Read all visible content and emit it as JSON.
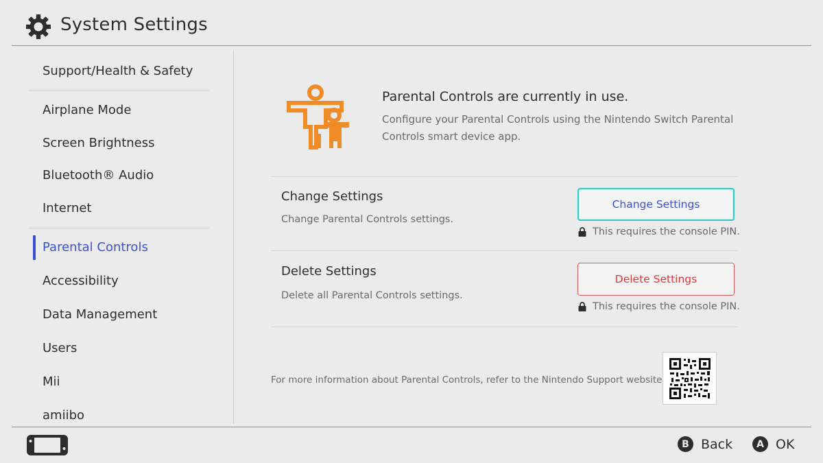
{
  "header": {
    "title": "System Settings",
    "icon": "gear-icon"
  },
  "sidebar": {
    "items": [
      {
        "label": "Support/Health & Safety"
      },
      {
        "label": "Airplane Mode"
      },
      {
        "label": "Screen Brightness"
      },
      {
        "label": "Bluetooth® Audio"
      },
      {
        "label": "Internet"
      },
      {
        "label": "Parental Controls",
        "active": true
      },
      {
        "label": "Accessibility"
      },
      {
        "label": "Data Management"
      },
      {
        "label": "Users"
      },
      {
        "label": "Mii"
      },
      {
        "label": "amiibo"
      }
    ]
  },
  "main": {
    "intro": {
      "title": "Parental Controls are currently in use.",
      "description": "Configure your Parental Controls using the Nintendo Switch Parental Controls smart device app."
    },
    "change": {
      "title": "Change Settings",
      "description": "Change Parental Controls settings.",
      "button_label": "Change Settings",
      "pin_note": "This requires the console PIN."
    },
    "delete": {
      "title": "Delete Settings",
      "description": "Delete all Parental Controls settings.",
      "button_label": "Delete Settings",
      "pin_note": "This requires the console PIN."
    },
    "more_info": "For more information about Parental Controls, refer to the Nintendo Support website."
  },
  "footer": {
    "back": {
      "glyph": "B",
      "label": "Back"
    },
    "ok": {
      "glyph": "A",
      "label": "OK"
    }
  },
  "colors": {
    "accent_blue": "#3c53cf",
    "focus_cyan": "#37c8c8",
    "danger_red": "#e0383d",
    "parental_orange": "#f08c28",
    "background": "#ebebeb"
  }
}
